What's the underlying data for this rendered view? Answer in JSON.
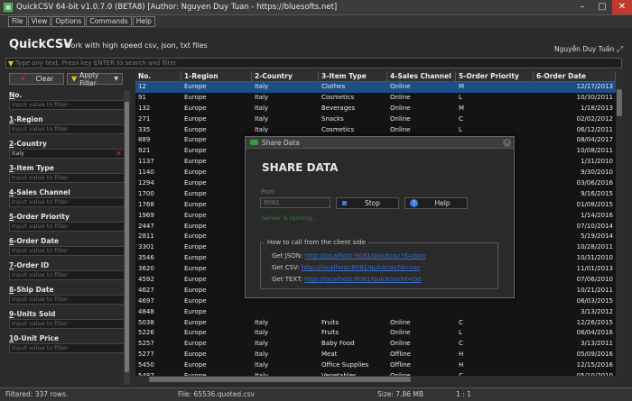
{
  "window": {
    "title": "QuickCSV 64-bit v1.0.7.0 (BETA8) [Author: Nguyen Duy Tuan - https://bluesofts.net]",
    "min": "–",
    "max": "□",
    "close": "✕"
  },
  "menu": [
    "File",
    "View",
    "Options",
    "Commands",
    "Help"
  ],
  "header": {
    "title": "QuickCSV",
    "subtitle": "Work with high speed csv, json, txt files",
    "user": "Nguyễn Duy Tuấn",
    "expand_icon": "⤢"
  },
  "search": {
    "placeholder": "Type any text. Press key ENTER to search and filter"
  },
  "sidebar": {
    "clear_label": "Clear",
    "apply_label": "Apply Filter",
    "filters": [
      {
        "label": "No.",
        "ul": "N",
        "rest": "o.",
        "value": "",
        "placeholder": "Input value to filter"
      },
      {
        "label": "1-Region",
        "ul": "1",
        "rest": "-Region",
        "value": "",
        "placeholder": "Input value to filter"
      },
      {
        "label": "2-Country",
        "ul": "2",
        "rest": "-Country",
        "value": "italy",
        "placeholder": ""
      },
      {
        "label": "3-Item Type",
        "ul": "3",
        "rest": "-Item Type",
        "value": "",
        "placeholder": "Input value to filter"
      },
      {
        "label": "4-Sales Channel",
        "ul": "4",
        "rest": "-Sales Channel",
        "value": "",
        "placeholder": "Input value to filter"
      },
      {
        "label": "5-Order Priority",
        "ul": "5",
        "rest": "-Order Priority",
        "value": "",
        "placeholder": "Input value to filter"
      },
      {
        "label": "6-Order Date",
        "ul": "6",
        "rest": "-Order Date",
        "value": "",
        "placeholder": "Input value to filter"
      },
      {
        "label": "7-Order ID",
        "ul": "7",
        "rest": "-Order ID",
        "value": "",
        "placeholder": "Input value to filter"
      },
      {
        "label": "8-Ship Date",
        "ul": "8",
        "rest": "-Ship Date",
        "value": "",
        "placeholder": "Input value to filter"
      },
      {
        "label": "9-Units Sold",
        "ul": "9",
        "rest": "-Units Sold",
        "value": "",
        "placeholder": "Input value to filter"
      },
      {
        "label": "10-Unit Price",
        "ul": "1",
        "rest": "0-Unit Price",
        "value": "",
        "placeholder": "Input value to filter"
      }
    ]
  },
  "grid": {
    "columns": [
      "No.",
      "1-Region",
      "2-Country",
      "3-Item Type",
      "4-Sales Channel",
      "5-Order Priority",
      "6-Order Date"
    ],
    "rows": [
      [
        "12",
        "Europe",
        "Italy",
        "Clothes",
        "Online",
        "M",
        "12/17/2013"
      ],
      [
        "91",
        "Europe",
        "Italy",
        "Cosmetics",
        "Online",
        "L",
        "10/30/2011"
      ],
      [
        "132",
        "Europe",
        "Italy",
        "Beverages",
        "Online",
        "M",
        "1/18/2013"
      ],
      [
        "271",
        "Europe",
        "Italy",
        "Snacks",
        "Online",
        "C",
        "02/02/2012"
      ],
      [
        "335",
        "Europe",
        "Italy",
        "Cosmetics",
        "Online",
        "L",
        "06/12/2011"
      ],
      [
        "889",
        "Europe",
        "",
        "",
        "",
        "",
        "08/04/2017"
      ],
      [
        "921",
        "Europe",
        "",
        "",
        "",
        "",
        "10/08/2011"
      ],
      [
        "1137",
        "Europe",
        "",
        "",
        "",
        "",
        "1/31/2010"
      ],
      [
        "1140",
        "Europe",
        "",
        "",
        "",
        "",
        "9/30/2010"
      ],
      [
        "1294",
        "Europe",
        "",
        "",
        "",
        "",
        "03/06/2016"
      ],
      [
        "1700",
        "Europe",
        "",
        "",
        "",
        "",
        "9/16/2015"
      ],
      [
        "1768",
        "Europe",
        "",
        "",
        "",
        "",
        "01/08/2015"
      ],
      [
        "1969",
        "Europe",
        "",
        "",
        "",
        "",
        "1/14/2016"
      ],
      [
        "2447",
        "Europe",
        "",
        "",
        "",
        "",
        "07/10/2014"
      ],
      [
        "2811",
        "Europe",
        "",
        "",
        "",
        "",
        "5/19/2014"
      ],
      [
        "3301",
        "Europe",
        "",
        "",
        "",
        "",
        "10/28/2011"
      ],
      [
        "3546",
        "Europe",
        "",
        "",
        "",
        "",
        "10/31/2010"
      ],
      [
        "3620",
        "Europe",
        "",
        "",
        "",
        "",
        "11/01/2013"
      ],
      [
        "4592",
        "Europe",
        "",
        "",
        "",
        "",
        "07/06/2010"
      ],
      [
        "4627",
        "Europe",
        "",
        "",
        "",
        "",
        "10/21/2011"
      ],
      [
        "4697",
        "Europe",
        "",
        "",
        "",
        "",
        "06/03/2015"
      ],
      [
        "4848",
        "Europe",
        "",
        "",
        "",
        "",
        "3/13/2012"
      ],
      [
        "5038",
        "Europe",
        "Italy",
        "Fruits",
        "Online",
        "C",
        "12/26/2015"
      ],
      [
        "5226",
        "Europe",
        "Italy",
        "Fruits",
        "Online",
        "L",
        "06/04/2016"
      ],
      [
        "5257",
        "Europe",
        "Italy",
        "Baby Food",
        "Online",
        "C",
        "3/13/2011"
      ],
      [
        "5277",
        "Europe",
        "Italy",
        "Meat",
        "Offline",
        "H",
        "05/09/2016"
      ],
      [
        "5450",
        "Europe",
        "Italy",
        "Office Supplies",
        "Offline",
        "H",
        "12/15/2016"
      ],
      [
        "5487",
        "Europe",
        "Italy",
        "Vegetables",
        "Online",
        "C",
        "05/10/2010"
      ]
    ]
  },
  "status": {
    "filtered": "Filtered: 337 rows.",
    "file": "File: 65536.quoted.csv",
    "size": "Size: 7.86 MB",
    "pos": "1 : 1"
  },
  "dialog": {
    "title": "Share Data",
    "heading": "SHARE DATA",
    "port_label": "Port:",
    "port_value": "8081",
    "stop_label": "Stop",
    "help_label": "Help",
    "status_text": "Server is running...",
    "box_title": "How to call from the client side",
    "links": [
      {
        "label": "Get JSON:",
        "url": "http://localhost:8081/quickcsv?d=json"
      },
      {
        "label": "Get CSV:",
        "url": "http://localhost:8081/quickcsv?d=csv"
      },
      {
        "label": "Get TEXT:",
        "url": "http://localhost:8081/quickcsv?d=txt"
      }
    ]
  }
}
